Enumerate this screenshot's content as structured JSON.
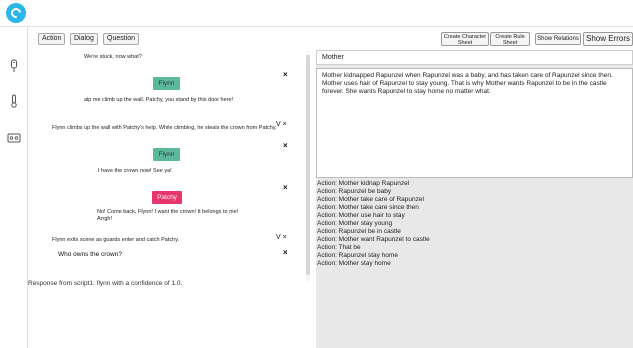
{
  "toolbar": {
    "action": "Action",
    "dialog": "Dialog",
    "question": "Question"
  },
  "right_toolbar": {
    "create_character_sheet": "Create Character Sheet",
    "create_rule_sheet": "Create Rule Sheet",
    "show_relations": "Show Relations",
    "show_errors": "Show Errors"
  },
  "script": {
    "line1": "We're stuck, now what?",
    "flynn_tag1": "Flynn",
    "line2": "alp me climb up the wall. Patchy, you stand by this door here!",
    "action1": "Flynn climbs up the wall with Patchy's help. While climbing, he steals the crown from Patchy.",
    "flynn_tag2": "Flynn",
    "line3": "I have the crown now! See ya!",
    "patchy_tag": "Patchy",
    "line4": "No! Come back, Flynn! I want the crown! It belongs to me! Arrgh!",
    "action2": "Flynn exits scene as guards enter and catch Patchy.",
    "question": "Who owns the crown?",
    "close_glyph": "×",
    "vx_glyph": "V ×"
  },
  "response": "Response from script1: flynn with a confidence of 1.0.",
  "character": {
    "name": "Mother",
    "description": "Mother kidnapped Rapunzel when Rapunzel was a baby, and has taken care of Rapunzel since then. Mother uses hair of Rapunzel to stay young. That is why Mother wants Rapunzel to be in the castle forever. She wants Rapunzel to stay home no matter what."
  },
  "actions": [
    "Action: Mother kidnap Rapunzel",
    "Action: Rapunzel be baby",
    "Action: Mother take care of Rapunzel",
    "Action: Mother take care since then",
    "Action: Mother use hair to stay",
    "Action: Mother stay young",
    "Action: Rapunzel be in castle",
    "Action: Mother want Rapunzel to castle",
    "Action: That be",
    "Action: Rapunzel stay home",
    "Action: Mother stay home"
  ],
  "icons": {
    "logo": "app-logo-icon",
    "usb": "usb-icon",
    "thermometer": "thermometer-icon",
    "cassette": "cassette-icon"
  },
  "colors": {
    "logo": "#2bb6e8",
    "flynn": "#5bb89b",
    "patchy": "#e8356b"
  }
}
